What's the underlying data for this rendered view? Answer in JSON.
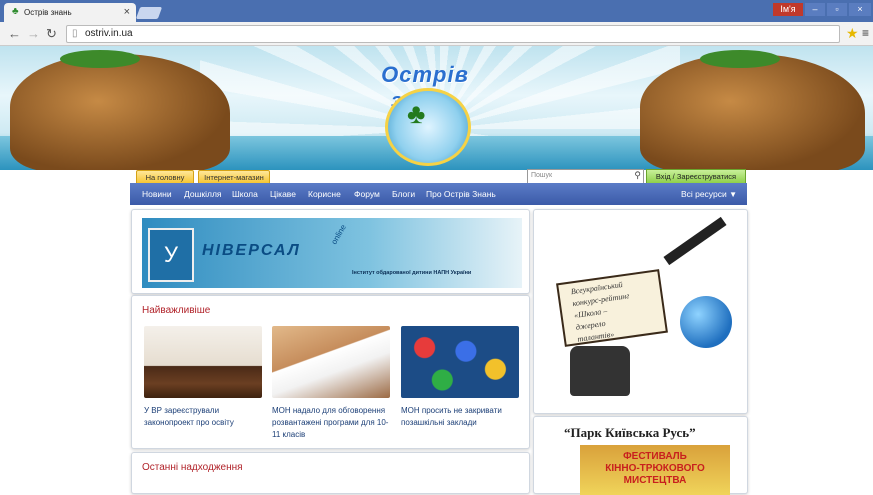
{
  "browser": {
    "tab_title": "Острів знань",
    "tab_close": "×",
    "user_badge": "Ім'я",
    "url": "ostriv.in.ua"
  },
  "top_nav": {
    "home_tab": "На головну",
    "shop_tab": "Інтернет-магазин",
    "search_placeholder": "Пошук",
    "login": "Вхід / Зареєструватися"
  },
  "logo_text": "Острів знань",
  "menu": {
    "items": [
      "Новини",
      "Дошкілля",
      "Школа",
      "Цікаве",
      "Корисне",
      "Форум",
      "Блоги",
      "Про Острів Знань"
    ],
    "all_resources": "Всі ресурси"
  },
  "universal_banner": {
    "name": "НІВЕРСАЛ",
    "letter": "У",
    "online": "online",
    "subtitle": "Інститут обдарованої дитини НАПН України"
  },
  "important": {
    "title": "Найважливіше",
    "news": [
      {
        "caption": "У ВР зареєстрували законопроект про освіту"
      },
      {
        "caption": "МОН надало для обговорення розвантажені програми для 10-11 класів"
      },
      {
        "caption": "МОН просить не закривати позашкільні заклади"
      }
    ]
  },
  "latest": {
    "title": "Останні надходження"
  },
  "side_ad": {
    "line1": "Всеукраїнський",
    "line2": "конкурс-рейтинг",
    "line3": "«Школа –",
    "line4": "джерело",
    "line5": "талантів»"
  },
  "side_ad2": {
    "title": "“Парк Київська Русь”",
    "line1": "ФЕСТИВАЛЬ",
    "line2": "КІННО-ТРЮКОВОГО",
    "line3": "МИСТЕЦТВА"
  }
}
